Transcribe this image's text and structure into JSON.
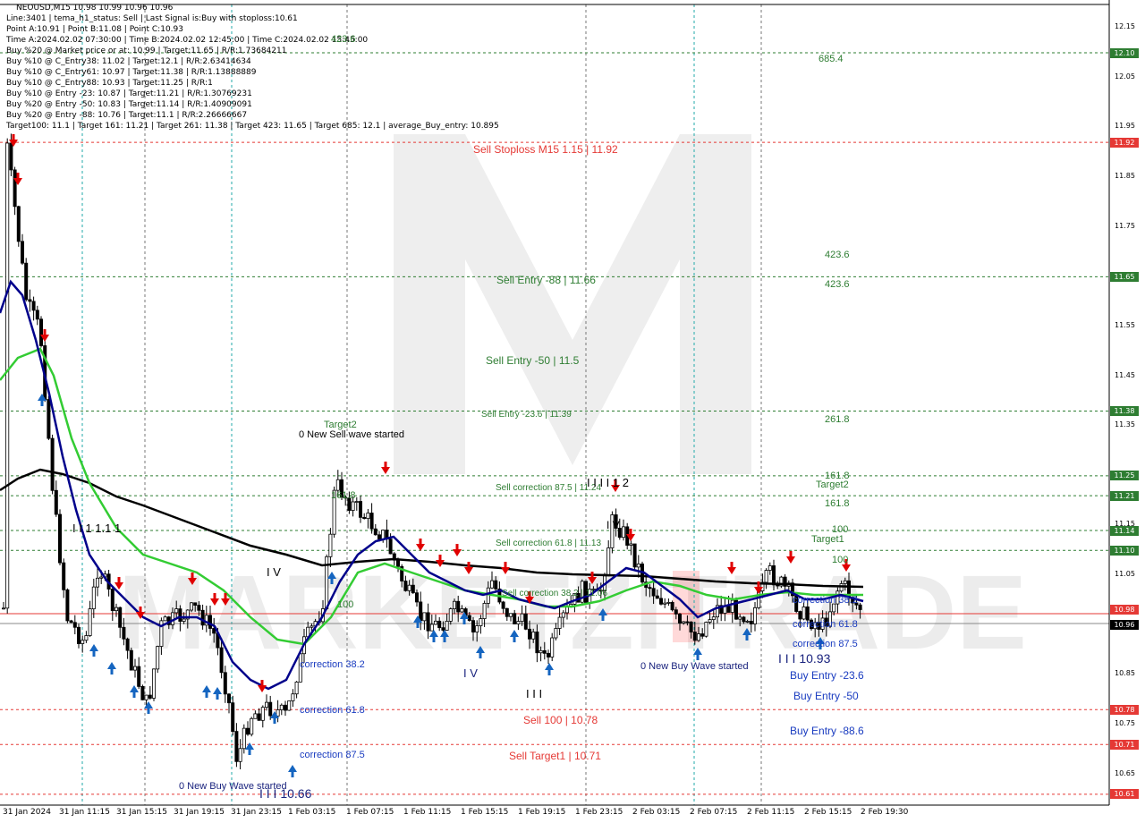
{
  "info": {
    "symbol_line": "NEOUSD,M15  10.98 10.99 10.96 10.96",
    "lines": [
      "Line:3401  |  tema_h1_status: Sell  |  Last Signal is:Buy with stoploss:10.61",
      "Point A:10.91  |  Point B:11.08  |  Point C:10.93",
      "Time A:2024.02.02 07:30:00  |  Time B:2024.02.02 12:45:00  |  Time C:2024.02.02 15:45:00",
      "Buy %20 @ Market price or at: 10.99  |  Target:11.65  |  R/R:1.73684211",
      "Buy %10 @ C_Entry38: 11.02  |  Target:12.1  |  R/R:2.63414634",
      "Buy %10 @ C_Entry61: 10.97  |  Target:11.38  |  R/R:1.13888889",
      "Buy %10 @ C_Entry88: 10.93  |  Target:11.25  |  R/R:1",
      "Buy %10 @ Entry -23: 10.87  |  Target:11.21  |  R/R:1.30769231",
      "Buy %20 @ Entry -50: 10.83  |  Target:11.14  |  R/R:1.40909091",
      "Buy %20 @ Entry -88: 10.76  |  Target:11.1  |  R/R:2.26666667",
      "Target100: 11.1  |  Target 161: 11.21  |  Target 261: 11.38  |  Target 423: 11.65  |  Target 685: 12.1  |  average_Buy_entry: 10.895"
    ]
  },
  "price_axis": {
    "ticks": [
      "12.15",
      "12.05",
      "11.95",
      "11.85",
      "11.75",
      "11.65",
      "11.55",
      "11.45",
      "11.35",
      "11.25",
      "11.15",
      "11.05",
      "10.95",
      "10.85",
      "10.75",
      "10.65"
    ],
    "tags": [
      {
        "label": "12.10",
        "price": 12.1,
        "color": "#2e7d32"
      },
      {
        "label": "11.92",
        "price": 11.92,
        "color": "#e53935"
      },
      {
        "label": "11.65",
        "price": 11.65,
        "color": "#2e7d32"
      },
      {
        "label": "11.38",
        "price": 11.38,
        "color": "#2e7d32"
      },
      {
        "label": "11.25",
        "price": 11.25,
        "color": "#2e7d32"
      },
      {
        "label": "11.21",
        "price": 11.21,
        "color": "#2e7d32"
      },
      {
        "label": "11.14",
        "price": 11.14,
        "color": "#2e7d32"
      },
      {
        "label": "11.10",
        "price": 11.1,
        "color": "#2e7d32"
      },
      {
        "label": "10.98",
        "price": 10.98,
        "color": "#e53935"
      },
      {
        "label": "10.96",
        "price": 10.96,
        "color": "#000000"
      },
      {
        "label": "10.78",
        "price": 10.78,
        "color": "#e53935"
      },
      {
        "label": "10.71",
        "price": 10.71,
        "color": "#e53935"
      },
      {
        "label": "10.61",
        "price": 10.61,
        "color": "#e53935"
      }
    ]
  },
  "time_axis": [
    "31 Jan 2024",
    "31 Jan 11:15",
    "31 Jan 15:15",
    "31 Jan 19:15",
    "31 Jan 23:15",
    "1 Feb 03:15",
    "1 Feb 07:15",
    "1 Feb 11:15",
    "1 Feb 15:15",
    "1 Feb 19:15",
    "1 Feb 23:15",
    "2 Feb 03:15",
    "2 Feb 07:15",
    "2 Feb 11:15",
    "2 Feb 15:15",
    "2 Feb 19:30"
  ],
  "levels": [
    {
      "price": 12.1,
      "color": "#2e7d32"
    },
    {
      "price": 11.92,
      "color": "#e53935"
    },
    {
      "price": 11.65,
      "color": "#2e7d32"
    },
    {
      "price": 11.38,
      "color": "#2e7d32"
    },
    {
      "price": 11.25,
      "color": "#2e7d32"
    },
    {
      "price": 11.21,
      "color": "#2e7d32"
    },
    {
      "price": 11.14,
      "color": "#2e7d32"
    },
    {
      "price": 11.1,
      "color": "#2e7d32"
    },
    {
      "price": 10.78,
      "color": "#e53935"
    },
    {
      "price": 10.71,
      "color": "#e53935"
    },
    {
      "price": 10.61,
      "color": "#e53935"
    }
  ],
  "annotations": {
    "level_labels": [
      {
        "text": "Sell Stoploss M15 1.15 | 11.92",
        "color": "#e53935"
      },
      {
        "text": "Sell Entry -88 | 11.66",
        "color": "#2e7d32"
      },
      {
        "text": "Sell Entry -50 | 11.5",
        "color": "#2e7d32"
      },
      {
        "text": "Sell Entry -23.6 | 11.39",
        "color": "#2e7d32"
      },
      {
        "text": "Sell correction 87.5 | 11.24",
        "color": "#2e7d32"
      },
      {
        "text": "Sell correction 61.8 | 11.13",
        "color": "#2e7d32"
      },
      {
        "text": "Sell correction 38.2 | 11.06",
        "color": "#2e7d32"
      },
      {
        "text": "Sell 100 | 10.78",
        "color": "#e53935"
      },
      {
        "text": "Sell Target1 | 10.71",
        "color": "#e53935"
      }
    ],
    "fib_labels": [
      {
        "text": "685.4"
      },
      {
        "text": "423.6"
      },
      {
        "text": "423.6"
      },
      {
        "text": "423.6"
      },
      {
        "text": "261.8"
      },
      {
        "text": "161.8"
      },
      {
        "text": "161.8"
      },
      {
        "text": "100"
      },
      {
        "text": "100"
      },
      {
        "text": "Target2"
      },
      {
        "text": "Target1"
      },
      {
        "text": "Target2"
      },
      {
        "text": "161.8"
      },
      {
        "text": "100"
      }
    ],
    "wave_labels": [
      {
        "text": "0 New Sell wave started",
        "color": "#000"
      },
      {
        "text": "0 New Buy Wave started",
        "color": "#1a237e"
      },
      {
        "text": "0 New Buy Wave started",
        "color": "#1a237e"
      },
      {
        "text": "I I I 10.66",
        "color": "#1a237e"
      },
      {
        "text": "I I I 10.93",
        "color": "#1a237e"
      },
      {
        "text": "I I I I 1 2",
        "color": "#000"
      },
      {
        "text": "I V",
        "color": "#1a237e"
      },
      {
        "text": "I V",
        "color": "#000"
      },
      {
        "text": "I V",
        "color": "#000"
      },
      {
        "text": "I I I",
        "color": "#000"
      },
      {
        "text": "I I I",
        "color": "#1a237e"
      },
      {
        "text": "I I 1 1.1 1",
        "color": "#000"
      }
    ],
    "buy_labels": [
      {
        "text": "correction 38.2"
      },
      {
        "text": "correction 61.8"
      },
      {
        "text": "correction 87.5"
      },
      {
        "text": "correction 38.2"
      },
      {
        "text": "correction 61.8"
      },
      {
        "text": "correction 87.5"
      },
      {
        "text": "Buy Entry -23.6"
      },
      {
        "text": "Buy Entry -50"
      },
      {
        "text": "Buy Entry -88.6"
      }
    ]
  },
  "watermark": "MARKETZITRADE",
  "colors": {
    "ma_black": "#000000",
    "ma_navy": "#00008b",
    "ma_green": "#33cc33",
    "sell_arrow": "#e00000",
    "buy_arrow": "#1565c0"
  }
}
